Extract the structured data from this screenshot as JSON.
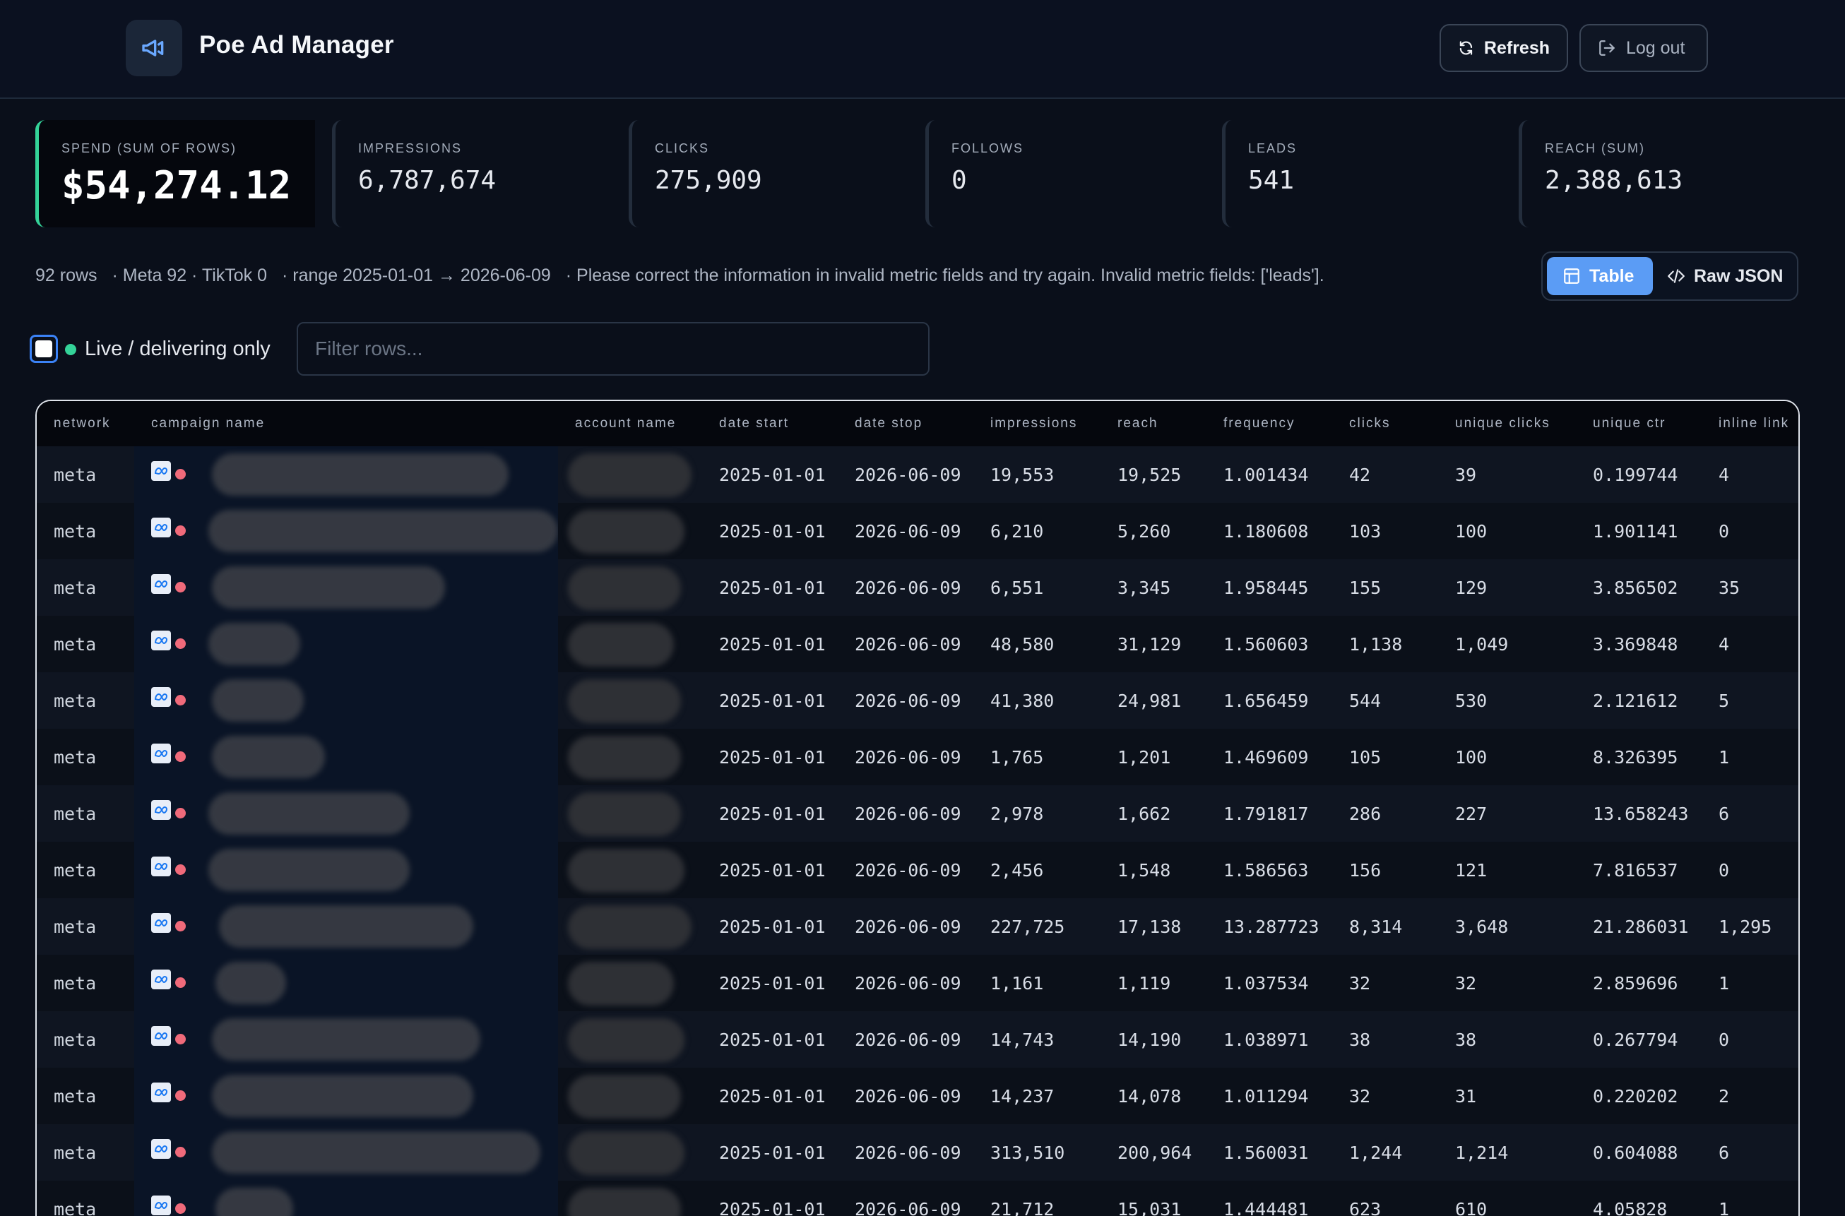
{
  "app": {
    "title": "Poe Ad Manager",
    "refresh_label": "Refresh",
    "logout_label": "Log out",
    "accent_color": "#5b9cf5",
    "success_color": "#34d399",
    "status_color": "#f06a7a"
  },
  "stats": [
    {
      "label": "SPEND (SUM OF ROWS)",
      "value": "$54,274.12"
    },
    {
      "label": "IMPRESSIONS",
      "value": "6,787,674"
    },
    {
      "label": "CLICKS",
      "value": "275,909"
    },
    {
      "label": "FOLLOWS",
      "value": "0"
    },
    {
      "label": "LEADS",
      "value": "541"
    },
    {
      "label": "REACH (SUM)",
      "value": "2,388,613"
    }
  ],
  "meta_line": {
    "rows": "92 rows",
    "networks": "· Meta 92 · TikTok 0",
    "range": "· range 2025-01-01 → 2026-06-09",
    "error": "· Please correct the information in invalid metric fields and try again. Invalid metric fields: ['leads']."
  },
  "view_toggle": {
    "table_label": "Table",
    "raw_label": "Raw JSON",
    "selected": "Table"
  },
  "filters": {
    "live_label": "Live / delivering only",
    "live_checked": false,
    "search_placeholder": "Filter rows...",
    "search_value": ""
  },
  "table": {
    "columns": [
      "network",
      "campaign name",
      "account name",
      "date start",
      "date stop",
      "impressions",
      "reach",
      "frequency",
      "clicks",
      "unique clicks",
      "unique ctr",
      "inline link"
    ],
    "rows": [
      {
        "network": "meta",
        "date_start": "2025-01-01",
        "date_stop": "2026-06-09",
        "impressions": "19,553",
        "reach": "19,525",
        "frequency": "1.001434",
        "clicks": "42",
        "unique_clicks": "39",
        "unique_ctr": "0.199744",
        "inline_link": "4"
      },
      {
        "network": "meta",
        "date_start": "2025-01-01",
        "date_stop": "2026-06-09",
        "impressions": "6,210",
        "reach": "5,260",
        "frequency": "1.180608",
        "clicks": "103",
        "unique_clicks": "100",
        "unique_ctr": "1.901141",
        "inline_link": "0"
      },
      {
        "network": "meta",
        "date_start": "2025-01-01",
        "date_stop": "2026-06-09",
        "impressions": "6,551",
        "reach": "3,345",
        "frequency": "1.958445",
        "clicks": "155",
        "unique_clicks": "129",
        "unique_ctr": "3.856502",
        "inline_link": "35"
      },
      {
        "network": "meta",
        "date_start": "2025-01-01",
        "date_stop": "2026-06-09",
        "impressions": "48,580",
        "reach": "31,129",
        "frequency": "1.560603",
        "clicks": "1,138",
        "unique_clicks": "1,049",
        "unique_ctr": "3.369848",
        "inline_link": "4"
      },
      {
        "network": "meta",
        "date_start": "2025-01-01",
        "date_stop": "2026-06-09",
        "impressions": "41,380",
        "reach": "24,981",
        "frequency": "1.656459",
        "clicks": "544",
        "unique_clicks": "530",
        "unique_ctr": "2.121612",
        "inline_link": "5"
      },
      {
        "network": "meta",
        "date_start": "2025-01-01",
        "date_stop": "2026-06-09",
        "impressions": "1,765",
        "reach": "1,201",
        "frequency": "1.469609",
        "clicks": "105",
        "unique_clicks": "100",
        "unique_ctr": "8.326395",
        "inline_link": "1"
      },
      {
        "network": "meta",
        "date_start": "2025-01-01",
        "date_stop": "2026-06-09",
        "impressions": "2,978",
        "reach": "1,662",
        "frequency": "1.791817",
        "clicks": "286",
        "unique_clicks": "227",
        "unique_ctr": "13.658243",
        "inline_link": "6"
      },
      {
        "network": "meta",
        "date_start": "2025-01-01",
        "date_stop": "2026-06-09",
        "impressions": "2,456",
        "reach": "1,548",
        "frequency": "1.586563",
        "clicks": "156",
        "unique_clicks": "121",
        "unique_ctr": "7.816537",
        "inline_link": "0"
      },
      {
        "network": "meta",
        "date_start": "2025-01-01",
        "date_stop": "2026-06-09",
        "impressions": "227,725",
        "reach": "17,138",
        "frequency": "13.287723",
        "clicks": "8,314",
        "unique_clicks": "3,648",
        "unique_ctr": "21.286031",
        "inline_link": "1,295"
      },
      {
        "network": "meta",
        "date_start": "2025-01-01",
        "date_stop": "2026-06-09",
        "impressions": "1,161",
        "reach": "1,119",
        "frequency": "1.037534",
        "clicks": "32",
        "unique_clicks": "32",
        "unique_ctr": "2.859696",
        "inline_link": "1"
      },
      {
        "network": "meta",
        "date_start": "2025-01-01",
        "date_stop": "2026-06-09",
        "impressions": "14,743",
        "reach": "14,190",
        "frequency": "1.038971",
        "clicks": "38",
        "unique_clicks": "38",
        "unique_ctr": "0.267794",
        "inline_link": "0"
      },
      {
        "network": "meta",
        "date_start": "2025-01-01",
        "date_stop": "2026-06-09",
        "impressions": "14,237",
        "reach": "14,078",
        "frequency": "1.011294",
        "clicks": "32",
        "unique_clicks": "31",
        "unique_ctr": "0.220202",
        "inline_link": "2"
      },
      {
        "network": "meta",
        "date_start": "2025-01-01",
        "date_stop": "2026-06-09",
        "impressions": "313,510",
        "reach": "200,964",
        "frequency": "1.560031",
        "clicks": "1,244",
        "unique_clicks": "1,214",
        "unique_ctr": "0.604088",
        "inline_link": "6"
      },
      {
        "network": "meta",
        "date_start": "2025-01-01",
        "date_stop": "2026-06-09",
        "impressions": "21,712",
        "reach": "15,031",
        "frequency": "1.444481",
        "clicks": "623",
        "unique_clicks": "610",
        "unique_ctr": "4.05828",
        "inline_link": "1"
      }
    ]
  },
  "icons": {
    "logo": "megaphone-icon",
    "refresh": "refresh-icon",
    "logout": "logout-icon",
    "table": "table-icon",
    "raw": "code-icon",
    "network": "meta-logo-icon",
    "status": "status-dot-icon"
  }
}
